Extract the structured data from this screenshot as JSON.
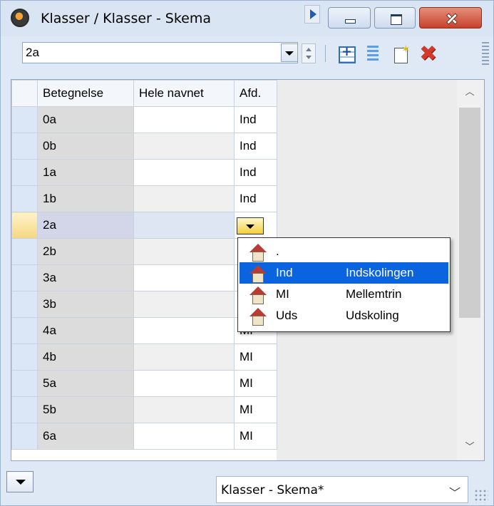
{
  "window": {
    "title": "Klasser / Klasser - Skema"
  },
  "toolbar": {
    "class_selector_value": "2a"
  },
  "grid": {
    "columns": [
      "Betegnelse",
      "Hele navnet",
      "Afd."
    ],
    "rows": [
      {
        "betegnelse": "0a",
        "hele_navnet": "",
        "afd": "Ind"
      },
      {
        "betegnelse": "0b",
        "hele_navnet": "",
        "afd": "Ind"
      },
      {
        "betegnelse": "1a",
        "hele_navnet": "",
        "afd": "Ind"
      },
      {
        "betegnelse": "1b",
        "hele_navnet": "",
        "afd": "Ind"
      },
      {
        "betegnelse": "2a",
        "hele_navnet": "",
        "afd": ""
      },
      {
        "betegnelse": "2b",
        "hele_navnet": "",
        "afd": ""
      },
      {
        "betegnelse": "3a",
        "hele_navnet": "",
        "afd": ""
      },
      {
        "betegnelse": "3b",
        "hele_navnet": "",
        "afd": ""
      },
      {
        "betegnelse": "4a",
        "hele_navnet": "",
        "afd": "MI"
      },
      {
        "betegnelse": "4b",
        "hele_navnet": "",
        "afd": "MI"
      },
      {
        "betegnelse": "5a",
        "hele_navnet": "",
        "afd": "MI"
      },
      {
        "betegnelse": "5b",
        "hele_navnet": "",
        "afd": "MI"
      },
      {
        "betegnelse": "6a",
        "hele_navnet": "",
        "afd": "MI"
      }
    ],
    "current_row": "2a"
  },
  "afd_popup": {
    "items": [
      {
        "code": ".",
        "name": "",
        "selected": false
      },
      {
        "code": "Ind",
        "name": "Indskolingen",
        "selected": true
      },
      {
        "code": "MI",
        "name": "Mellemtrin",
        "selected": false
      },
      {
        "code": "Uds",
        "name": "Udskoling",
        "selected": false
      }
    ],
    "icon": "house-icon"
  },
  "statusbar": {
    "layout_value": "Klasser - Skema*"
  },
  "colors": {
    "selection": "#0a64e0",
    "window_bg": "#dfe9f5",
    "close_button": "#c7412b"
  }
}
